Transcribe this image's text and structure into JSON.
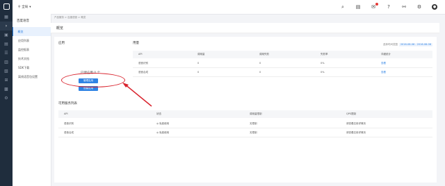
{
  "topbar": {
    "region": "全局",
    "icons": [
      "search-icon",
      "document-icon",
      "mail-icon",
      "help-icon",
      "share-icon",
      "settings-icon",
      "avatar"
    ]
  },
  "breadcrumb": "产品服务 > 百度语音 > 概览",
  "subnav": {
    "title": "百度语音",
    "items": [
      {
        "label": "概览",
        "active": true
      },
      {
        "label": "应用列表"
      },
      {
        "label": "监控报表"
      },
      {
        "label": "技术文档"
      },
      {
        "label": "SDK下载"
      },
      {
        "label": "离线语音包设置"
      }
    ]
  },
  "page": {
    "title": "概览"
  },
  "apps": {
    "section": "应用",
    "count_text": "已建应用  0 个",
    "manage_btn": "管理应用",
    "create_btn": "创建应用"
  },
  "usage": {
    "section": "用量",
    "range_label": "选择时间范围",
    "range_value": "2016-08-06 - 2016-08-08",
    "headers": [
      "API",
      "调用量",
      "调用失败",
      "失败率",
      "详细统计"
    ],
    "rows": [
      [
        "语音识别",
        "0",
        "0",
        "0%",
        "查看"
      ],
      [
        "语音合成",
        "0",
        "0",
        "0%",
        "查看"
      ]
    ]
  },
  "services": {
    "section": "可用服务列表",
    "headers": [
      "API",
      "状态",
      "调用量限制",
      "QPS限制"
    ],
    "rows": [
      [
        "语音识别",
        "免费使用",
        "无限制",
        "请查看应用详情页"
      ],
      [
        "语音合成",
        "免费使用",
        "无限制",
        "请查看应用详情页"
      ]
    ]
  },
  "colors": {
    "accent": "#2f83e4",
    "annotation": "#d9232d",
    "sidebar": "#1f2d3d"
  }
}
